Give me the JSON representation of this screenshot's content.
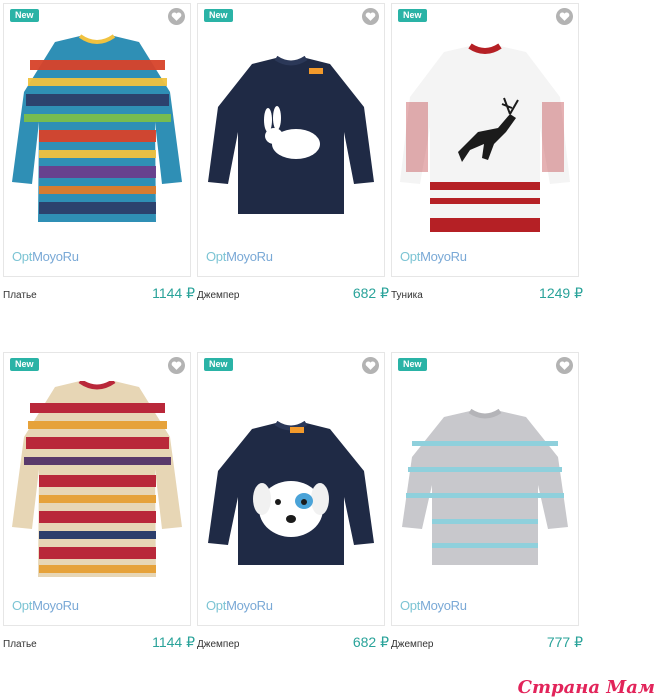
{
  "products": [
    {
      "badge": "New",
      "logo_a": "Opt",
      "logo_b": "MoyoRu",
      "name": "Платье",
      "price": "1144 ₽",
      "colors": {
        "body": "#2f8fb5",
        "band": "#d8432a",
        "accent": "#f0c240"
      }
    },
    {
      "badge": "New",
      "logo_a": "Opt",
      "logo_b": "MoyoRu",
      "name": "Джемпер",
      "price": "682 ₽",
      "colors": {
        "body": "#1f2a45",
        "motif": "#ffffff"
      }
    },
    {
      "badge": "New",
      "logo_a": "Opt",
      "logo_b": "MoyoRu",
      "name": "Туника",
      "price": "1249 ₽",
      "colors": {
        "body": "#f4f4f4",
        "band": "#b52025",
        "motif": "#1b1b1b"
      }
    },
    {
      "badge": "New",
      "logo_a": "Opt",
      "logo_b": "MoyoRu",
      "name": "Платье",
      "price": "1144 ₽",
      "colors": {
        "body": "#e7d6b5",
        "band": "#b9283a",
        "accent": "#e6a23a"
      }
    },
    {
      "badge": "New",
      "logo_a": "Opt",
      "logo_b": "MoyoRu",
      "name": "Джемпер",
      "price": "682 ₽",
      "colors": {
        "body": "#1f2a45",
        "motif": "#ffffff"
      }
    },
    {
      "badge": "New",
      "logo_a": "Opt",
      "logo_b": "MoyoRu",
      "name": "Джемпер",
      "price": "777 ₽",
      "colors": {
        "body": "#c8c8cc",
        "band": "#8fd0dc"
      }
    }
  ],
  "watermark": "Страна Мам",
  "icons": {
    "favorite": "heart-icon"
  }
}
